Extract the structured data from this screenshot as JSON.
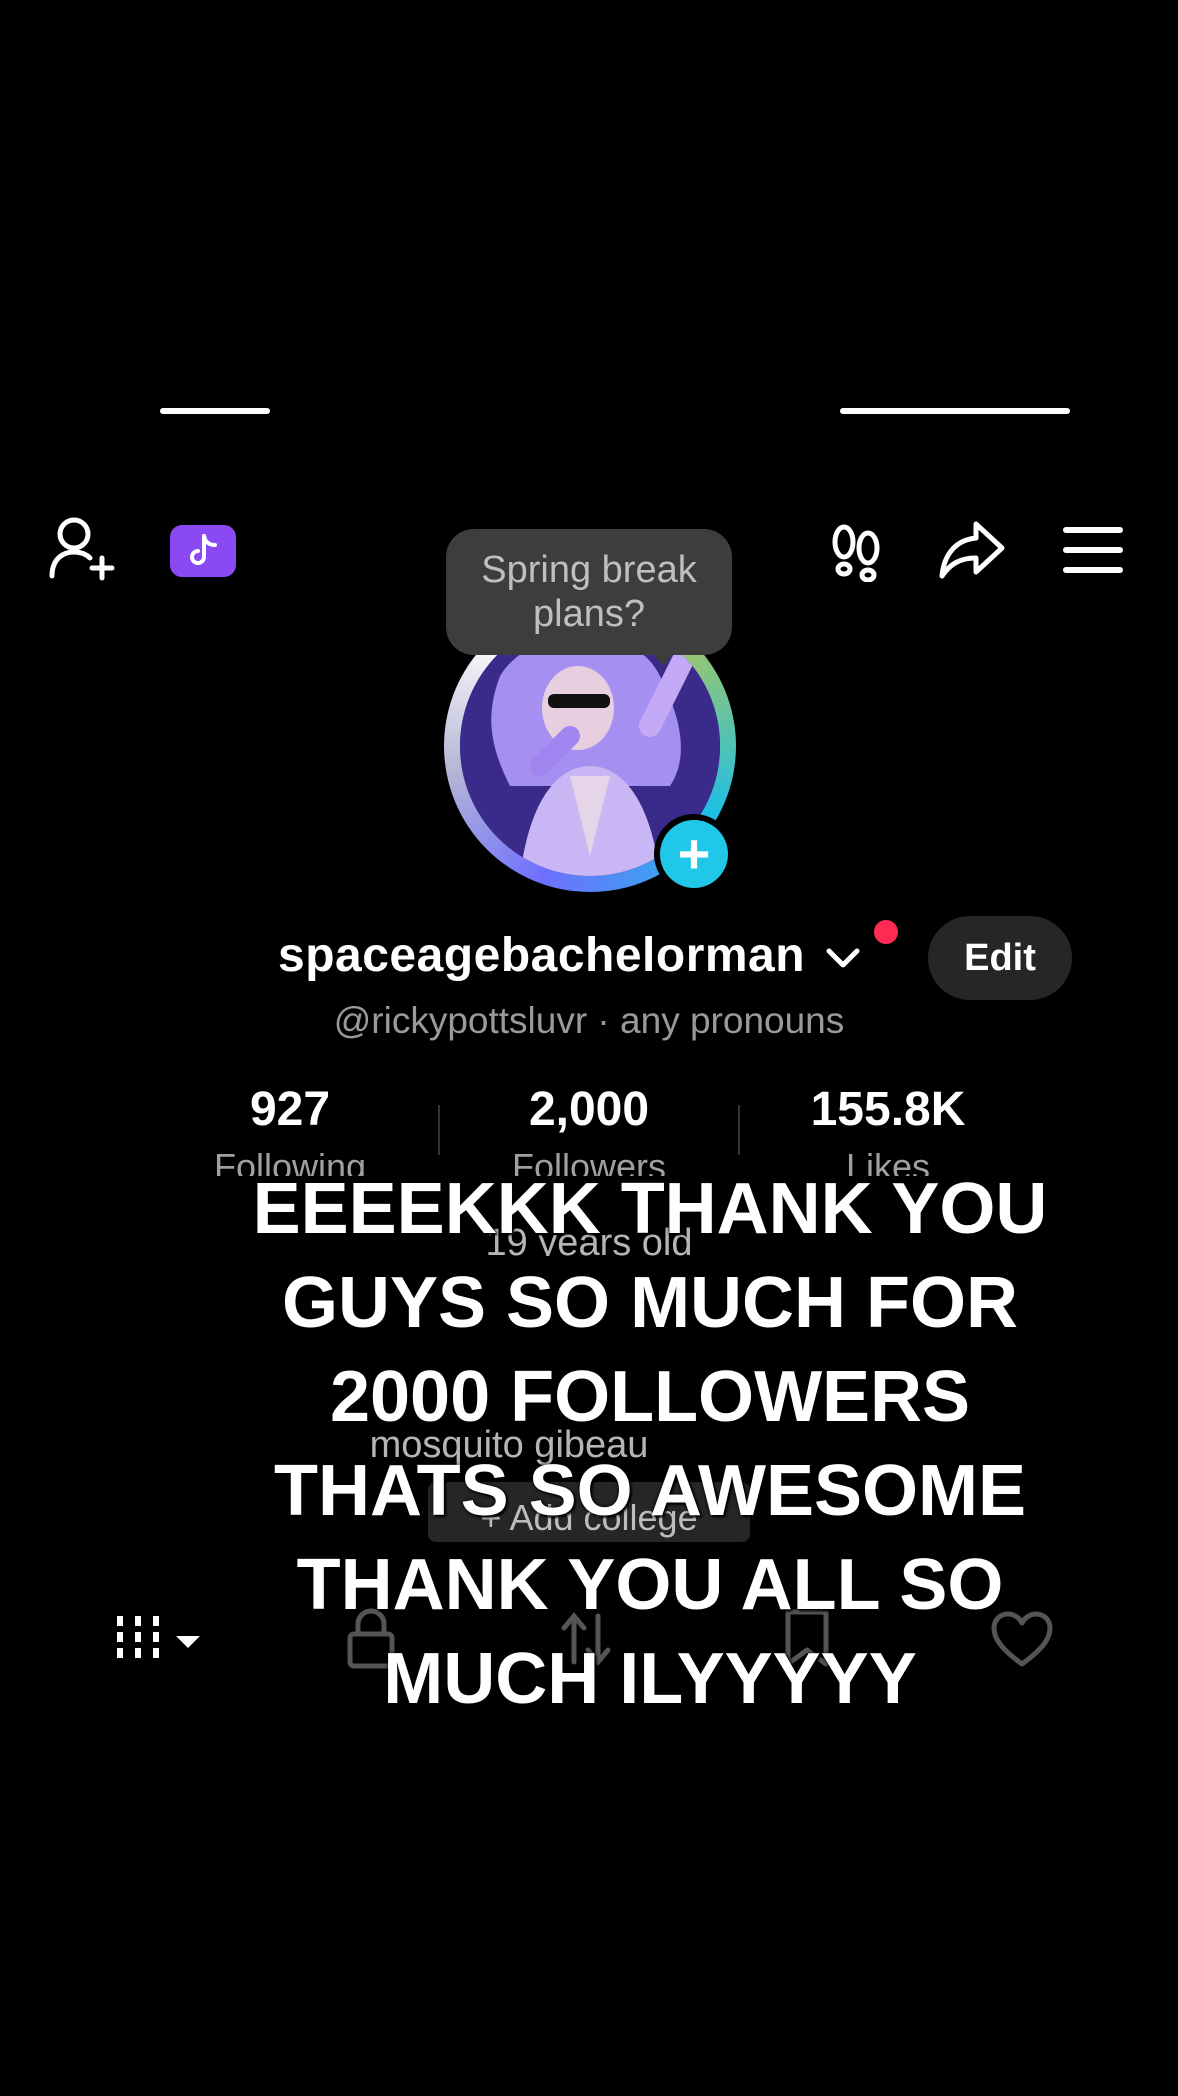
{
  "tooltip": {
    "line1": "Spring break",
    "line2": "plans?"
  },
  "profile": {
    "username": "spaceagebachelorman",
    "handle_line": "@rickypottsluvr · any pronouns",
    "edit_label": "Edit"
  },
  "stats": [
    {
      "value": "927",
      "label": "Following"
    },
    {
      "value": "2,000",
      "label": "Followers"
    },
    {
      "value": "155.8K",
      "label": "Likes"
    }
  ],
  "bio": {
    "age": "19 years old",
    "name_line": "mosquito gibeau",
    "add_college": "+ Add college"
  },
  "caption": {
    "lines": [
      "EEEEKKK THANK YOU",
      "GUYS SO MUCH FOR",
      "2000 FOLLOWERS",
      "THATS SO AWESOME",
      "THANK YOU ALL SO",
      "MUCH ILYYYYY"
    ]
  },
  "icons": {
    "add_friend": "person-plus-icon",
    "tiktok_badge": "tiktok-logo-icon",
    "footprints": "footprints-icon",
    "share": "share-arrow-icon",
    "menu": "hamburger-menu-icon",
    "grid_tab": "grid-icon",
    "lock_tab": "lock-icon",
    "repost_tab": "repost-icon",
    "saved_tab": "bookmark-icon",
    "liked_tab": "heart-icon"
  },
  "colors": {
    "accent_purple": "#8a49f2",
    "story_plus": "#20c7e8",
    "notification": "#fe2c55"
  }
}
